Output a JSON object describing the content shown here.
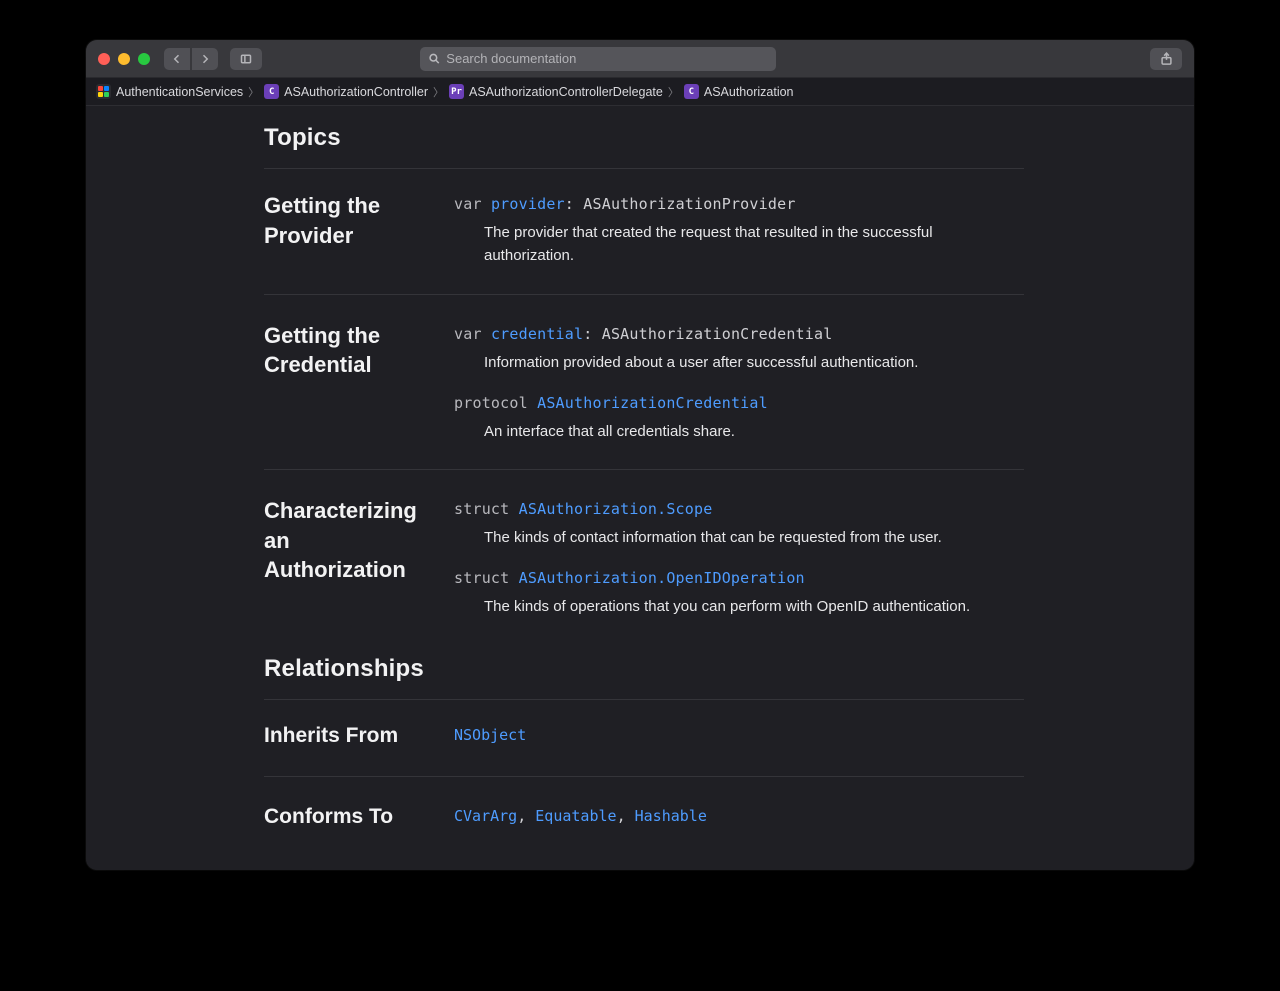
{
  "search": {
    "placeholder": "Search documentation"
  },
  "breadcrumbs": [
    {
      "badge": "fw",
      "label": "AuthenticationServices"
    },
    {
      "badge": "C",
      "label": "ASAuthorizationController"
    },
    {
      "badge": "Pr",
      "label": "ASAuthorizationControllerDelegate"
    },
    {
      "badge": "C",
      "label": "ASAuthorization"
    }
  ],
  "sections": {
    "topics_title": "Topics",
    "relationships_title": "Relationships",
    "groups": [
      {
        "title": "Getting the Provider",
        "items": [
          {
            "kw": "var",
            "sym": "provider",
            "suffix": ": ASAuthorizationProvider",
            "desc": "The provider that created the request that resulted in the successful authorization."
          }
        ]
      },
      {
        "title": "Getting the Credential",
        "items": [
          {
            "kw": "var",
            "sym": "credential",
            "suffix": ": ASAuthorizationCredential",
            "desc": "Information provided about a user after successful authentication."
          },
          {
            "kw": "protocol",
            "sym": "ASAuthorizationCredential",
            "suffix": "",
            "desc": "An interface that all credentials share."
          }
        ]
      },
      {
        "title": "Characterizing an Authorization",
        "items": [
          {
            "kw": "struct",
            "sym": "ASAuthorization.Scope",
            "suffix": "",
            "desc": "The kinds of contact information that can be requested from the user."
          },
          {
            "kw": "struct",
            "sym": "ASAuthorization.OpenIDOperation",
            "suffix": "",
            "desc": "The kinds of operations that you can perform with OpenID authentication."
          }
        ]
      }
    ],
    "inherits_title": "Inherits From",
    "inherits": [
      "NSObject"
    ],
    "conforms_title": "Conforms To",
    "conforms": [
      "CVarArg",
      "Equatable",
      "Hashable"
    ]
  }
}
